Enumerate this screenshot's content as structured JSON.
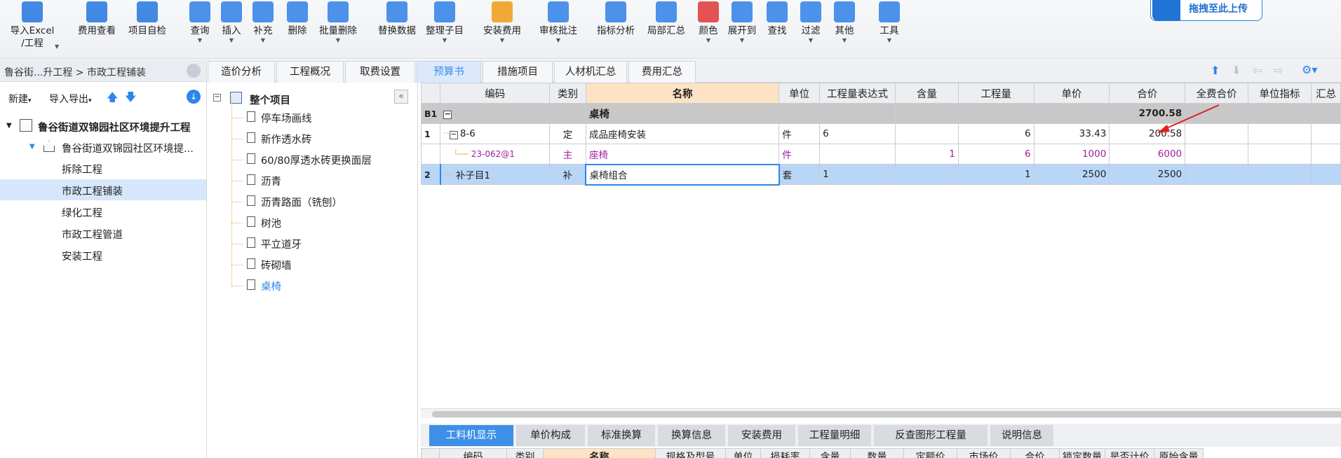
{
  "toolbar": {
    "items": [
      {
        "label": "导入Excel",
        "label2": "/工程",
        "caret": true,
        "icon": "excel-import-icon"
      },
      {
        "label": "费用查看",
        "icon": "fee-view-icon"
      },
      {
        "label": "项目自检",
        "icon": "self-check-icon"
      },
      {
        "label": "查询",
        "caret": true,
        "icon": "query-icon"
      },
      {
        "label": "插入",
        "caret": true,
        "icon": "insert-icon"
      },
      {
        "label": "补充",
        "caret": true,
        "icon": "supplement-icon"
      },
      {
        "label": "删除",
        "icon": "delete-icon"
      },
      {
        "label": "批量删除",
        "caret": true,
        "icon": "batch-delete-icon"
      },
      {
        "label": "替换数据",
        "icon": "replace-data-icon"
      },
      {
        "label": "整理子目",
        "caret": true,
        "icon": "organize-icon"
      },
      {
        "label": "安装费用",
        "caret": true,
        "icon": "install-fee-icon"
      },
      {
        "label": "审核批注",
        "caret": true,
        "icon": "review-icon"
      },
      {
        "label": "指标分析",
        "icon": "index-analysis-icon"
      },
      {
        "label": "局部汇总",
        "icon": "partial-summary-icon"
      },
      {
        "label": "颜色",
        "caret": true,
        "icon": "color-icon"
      },
      {
        "label": "展开到",
        "caret": true,
        "icon": "expand-to-icon"
      },
      {
        "label": "查找",
        "icon": "find-icon"
      },
      {
        "label": "过滤",
        "caret": true,
        "icon": "filter-icon"
      },
      {
        "label": "其他",
        "caret": true,
        "icon": "other-icon"
      },
      {
        "label": "工具",
        "caret": true,
        "icon": "tool-icon"
      }
    ],
    "upload_label": "拖拽至此上传"
  },
  "left": {
    "breadcrumb": "鲁谷街...升工程 > 市政工程铺装",
    "new_label": "新建",
    "io_label": "导入导出",
    "project": "鲁谷街道双锦园社区环境提升工程",
    "sub_project": "鲁谷街道双锦园社区环境提...",
    "units": [
      "拆除工程",
      "市政工程铺装",
      "绿化工程",
      "市政工程管道",
      "安装工程"
    ],
    "selected_unit": 1
  },
  "tabs": [
    "造价分析",
    "工程概况",
    "取费设置",
    "预算书",
    "措施项目",
    "人材机汇总",
    "费用汇总"
  ],
  "active_tab": 3,
  "mid_tree": {
    "root": "整个项目",
    "items": [
      "停车场画线",
      "新作透水砖",
      "60/80厚透水砖更换面层",
      "沥青",
      "沥青路面（铣刨）",
      "树池",
      "平立道牙",
      "砖砌墙",
      "桌椅"
    ],
    "selected": 8
  },
  "grid": {
    "headers": [
      "",
      "编码",
      "类别",
      "名称",
      "单位",
      "工程量表达式",
      "含量",
      "工程量",
      "单价",
      "合价",
      "全费合价",
      "单位指标",
      "汇总"
    ],
    "rows": [
      {
        "no": "B1",
        "code": "",
        "type": "",
        "name": "桌椅",
        "unit": "",
        "expr": "",
        "content": "",
        "qty": "",
        "price": "",
        "total": "2700.58"
      },
      {
        "no": "1",
        "code": "8-6",
        "type": "定",
        "name": "成品座椅安装",
        "unit": "件",
        "expr": "6",
        "content": "",
        "qty": "6",
        "price": "33.43",
        "total": "200.58"
      },
      {
        "no": "",
        "code": "23-062@1",
        "type": "主",
        "name": "座椅",
        "unit": "件",
        "expr": "",
        "content": "1",
        "qty": "6",
        "price": "1000",
        "total": "6000"
      },
      {
        "no": "2",
        "code": "补子目1",
        "type": "补",
        "name": "桌椅组合",
        "unit": "套",
        "expr": "1",
        "content": "",
        "qty": "1",
        "price": "2500",
        "total": "2500"
      }
    ]
  },
  "bottom_tabs": [
    "工料机显示",
    "单价构成",
    "标准换算",
    "换算信息",
    "安装费用",
    "工程量明细",
    "反查图形工程量",
    "说明信息"
  ],
  "bottom_headers": [
    "编码",
    "类别",
    "名称",
    "规格及型号",
    "单位",
    "损耗率",
    "含量",
    "数量",
    "定额价",
    "市场价",
    "合价",
    "锁定数量",
    "是否计价",
    "原始含量"
  ]
}
